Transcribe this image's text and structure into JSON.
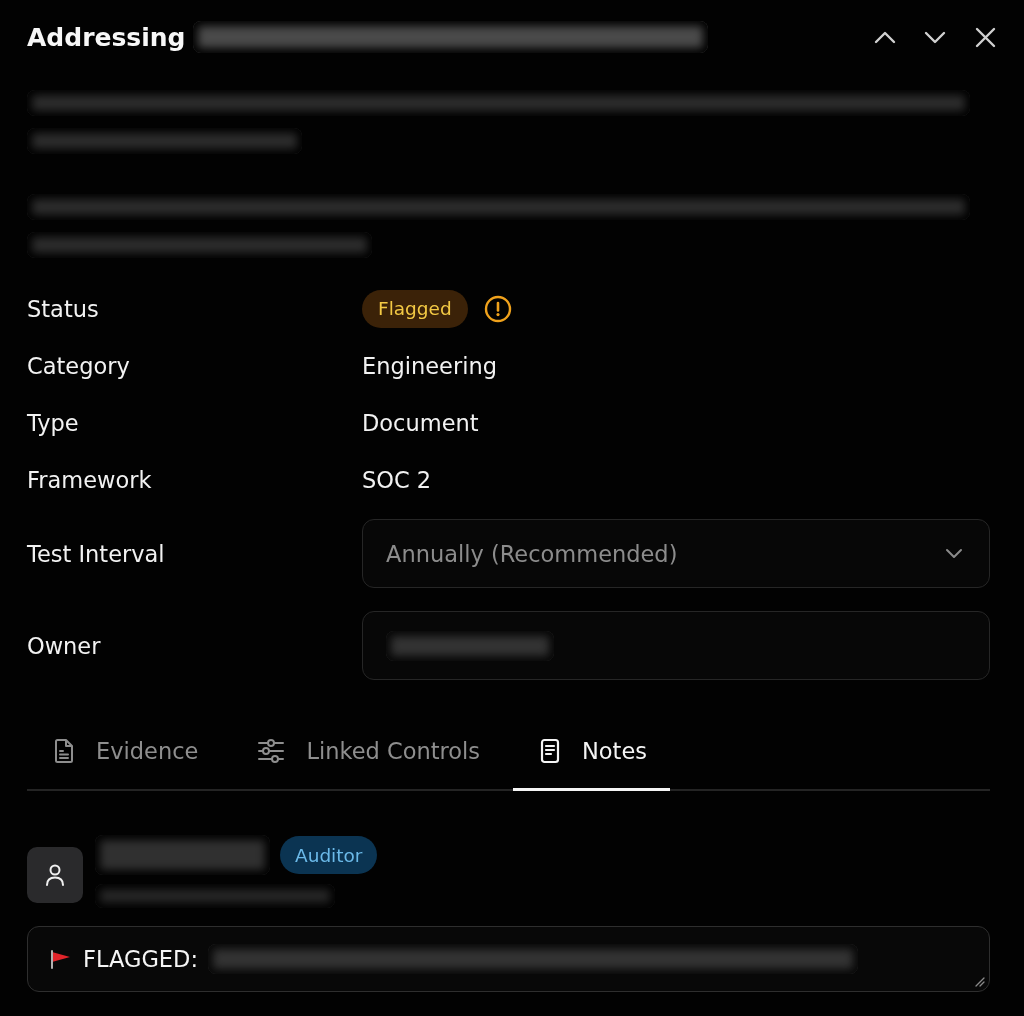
{
  "header": {
    "title": "Addressing"
  },
  "fields": [
    {
      "label": "Status",
      "kind": "status",
      "value": "Flagged",
      "warning": true
    },
    {
      "label": "Category",
      "kind": "text",
      "value": "Engineering"
    },
    {
      "label": "Type",
      "kind": "text",
      "value": "Document"
    },
    {
      "label": "Framework",
      "kind": "text",
      "value": "SOC 2"
    },
    {
      "label": "Test Interval",
      "kind": "select",
      "value": "Annually (Recommended)"
    },
    {
      "label": "Owner",
      "kind": "select"
    }
  ],
  "tabs": [
    {
      "label": "Evidence",
      "selected": false
    },
    {
      "label": "Linked Controls",
      "selected": false
    },
    {
      "label": "Notes",
      "selected": true
    }
  ],
  "notes": [
    {
      "role": "Auditor",
      "flag": true,
      "text": "FLAGGED:"
    }
  ]
}
